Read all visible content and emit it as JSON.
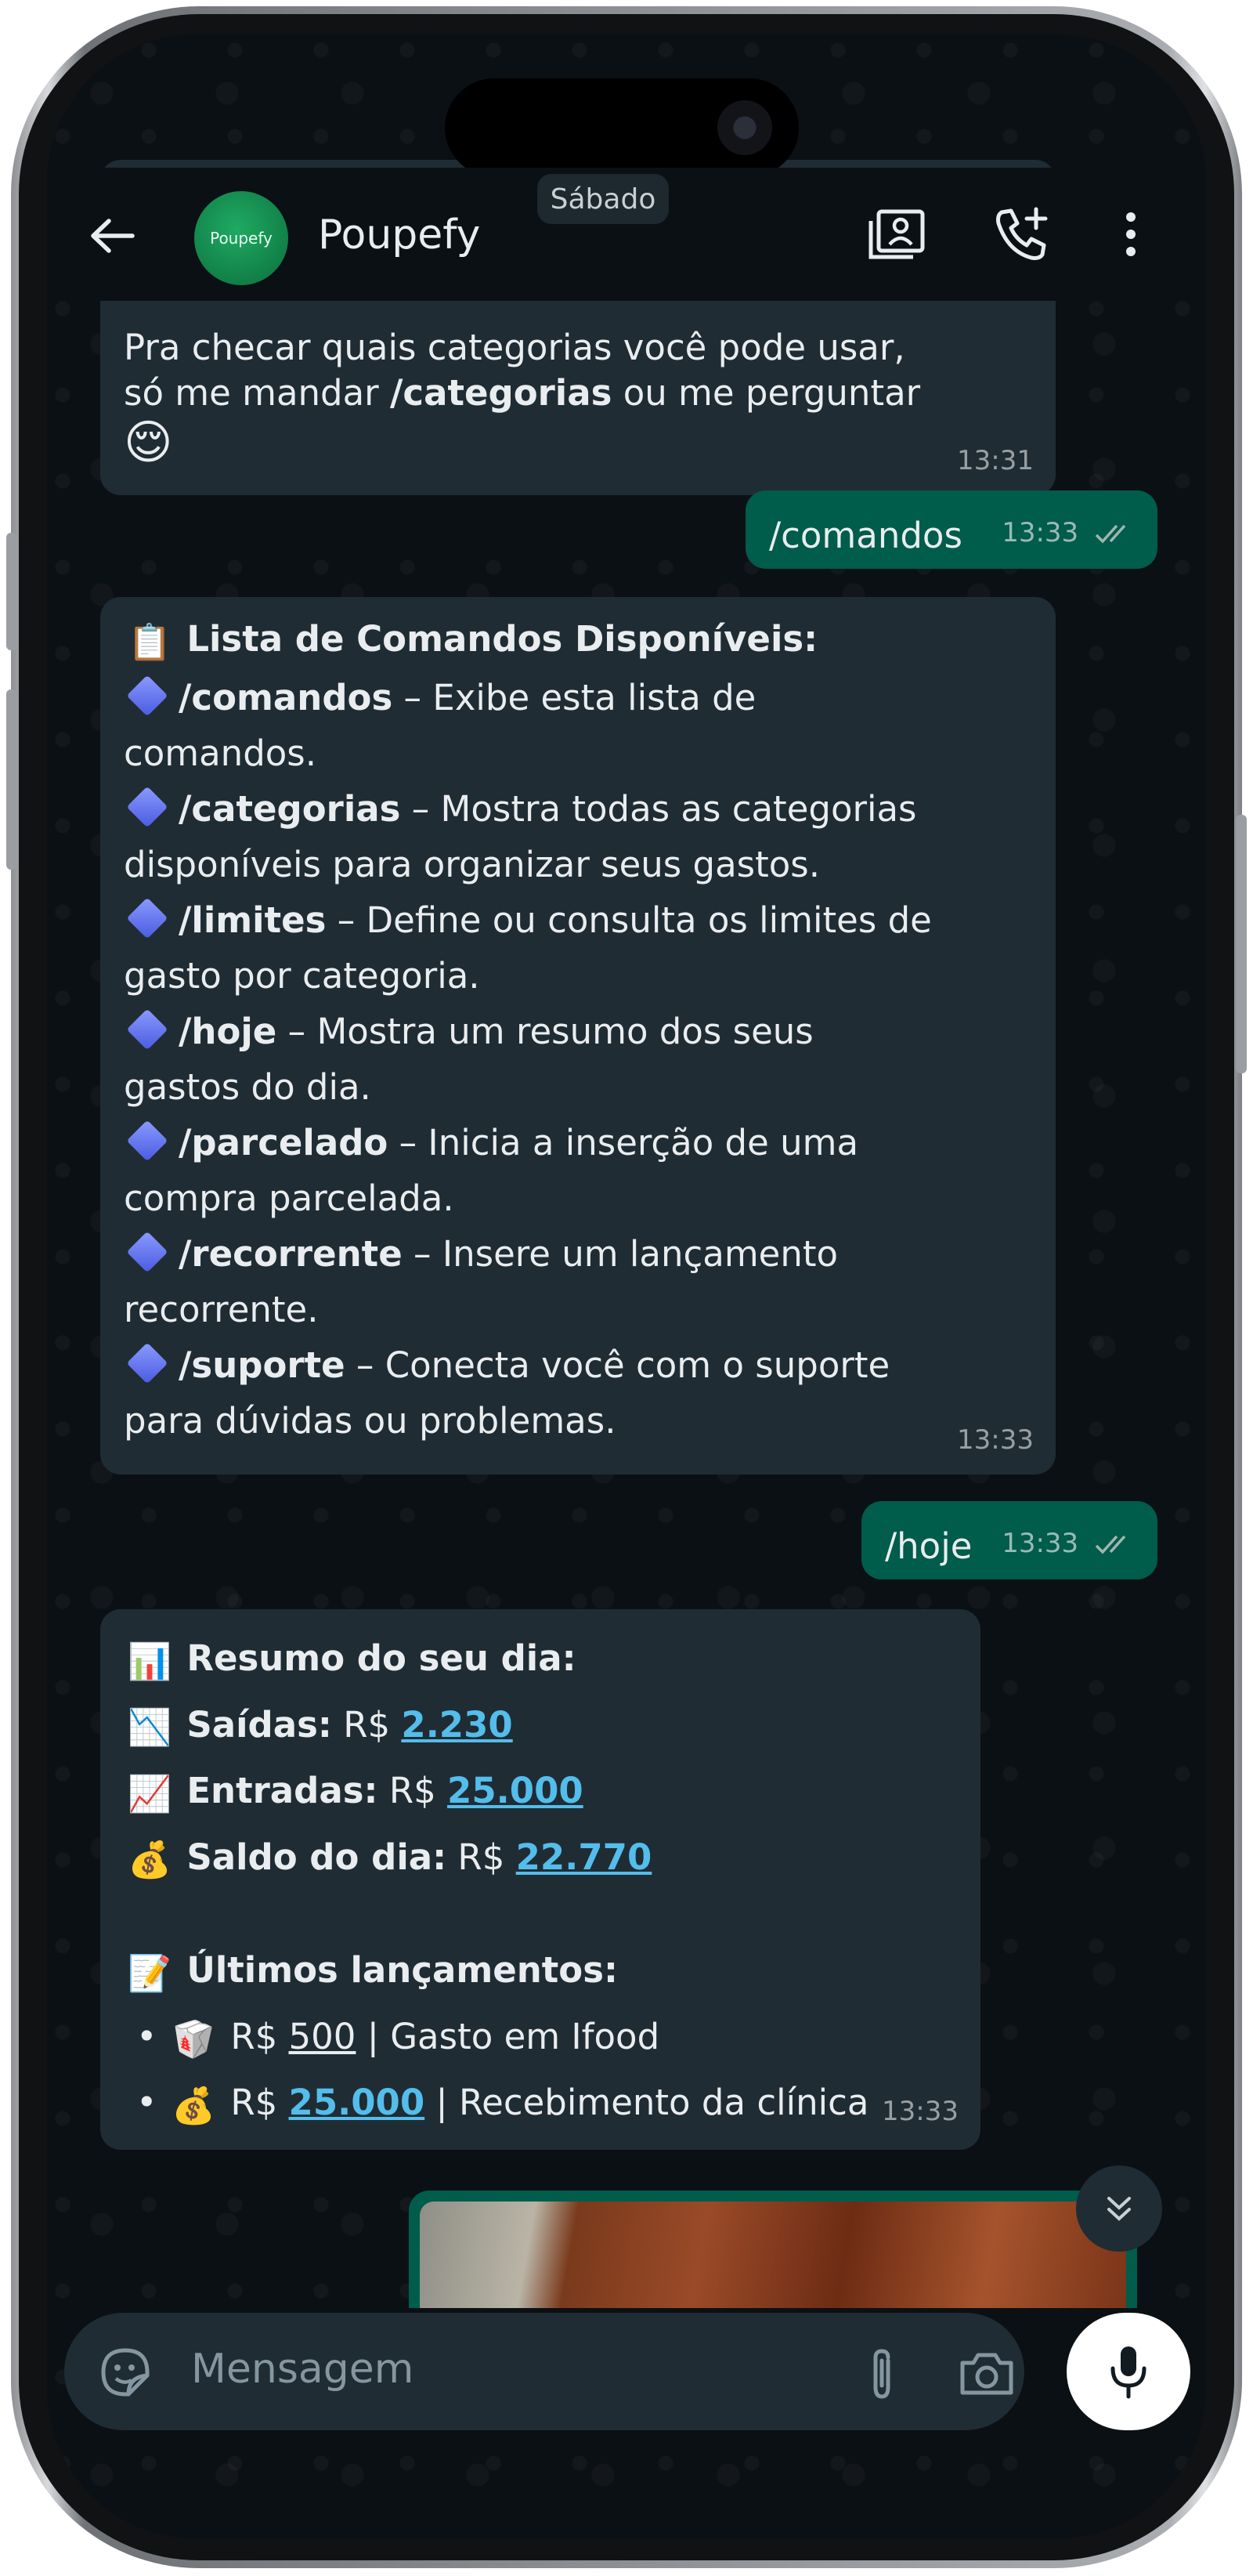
{
  "header": {
    "contact_name": "Poupefy",
    "avatar_text": "Poupefy",
    "icons": [
      "back-arrow-icon",
      "contact-card-icon",
      "add-call-icon",
      "more-vert-icon"
    ]
  },
  "date_pill": "Sábado",
  "messages": {
    "m1": {
      "line1": "Pra checar quais categorias você pode usar,",
      "line2_pre": "só me mandar ",
      "line2_bold": "/categorias",
      "line2_post": " ou me perguntar",
      "emoji": "😌",
      "time": "13:31"
    },
    "m2": {
      "text": "/comandos",
      "time": "13:33"
    },
    "m3": {
      "title_emoji": "📋",
      "title": "Lista de Comandos Disponíveis:",
      "commands": [
        {
          "cmd": "/comandos",
          "desc": " – Exibe esta lista de",
          "desc2": "comandos."
        },
        {
          "cmd": "/categorias",
          "desc": " – Mostra todas as categorias",
          "desc2": "disponíveis para organizar seus gastos."
        },
        {
          "cmd": "/limites",
          "desc": " – Define ou consulta os limites de",
          "desc2": "gasto por categoria."
        },
        {
          "cmd": "/hoje",
          "desc": " – Mostra um resumo dos seus",
          "desc2": "gastos do dia."
        },
        {
          "cmd": "/parcelado",
          "desc": " – Inicia a inserção de uma",
          "desc2": "compra parcelada."
        },
        {
          "cmd": "/recorrente",
          "desc": " – Insere um lançamento",
          "desc2": "recorrente."
        },
        {
          "cmd": "/suporte",
          "desc": " – Conecta você com o suporte",
          "desc2": "para dúvidas ou problemas."
        }
      ],
      "time": "13:33"
    },
    "m4": {
      "text": "/hoje",
      "time": "13:33"
    },
    "m5": {
      "title_emoji": "📊",
      "title": "Resumo do seu dia:",
      "saidas_emoji": "📉",
      "saidas_label": "Saídas:",
      "saidas_currency": "R$ ",
      "saidas_value": "2.230",
      "entradas_emoji": "📈",
      "entradas_label": "Entradas:",
      "entradas_currency": "R$ ",
      "entradas_value": "25.000",
      "saldo_emoji": "💰",
      "saldo_label": "Saldo do dia:",
      "saldo_currency": "R$ ",
      "saldo_value": "22.770",
      "ultimos_emoji": "📝",
      "ultimos_title": "Últimos lançamentos:",
      "items": [
        {
          "emoji": "🥡",
          "currency": "R$ ",
          "value": "500",
          "desc": " | Gasto em Ifood"
        },
        {
          "emoji": "💰",
          "currency": "R$ ",
          "value": "25.000",
          "desc": " | Recebimento da clínica"
        }
      ],
      "time": "13:33"
    }
  },
  "composer": {
    "placeholder": "Mensagem",
    "icons": [
      "sticker-icon",
      "attach-icon",
      "camera-icon",
      "mic-icon"
    ]
  },
  "colors": {
    "incoming_bubble": "#202c33",
    "outgoing_bubble": "#005c4b",
    "link": "#53bdeb",
    "background": "#0b1014"
  }
}
